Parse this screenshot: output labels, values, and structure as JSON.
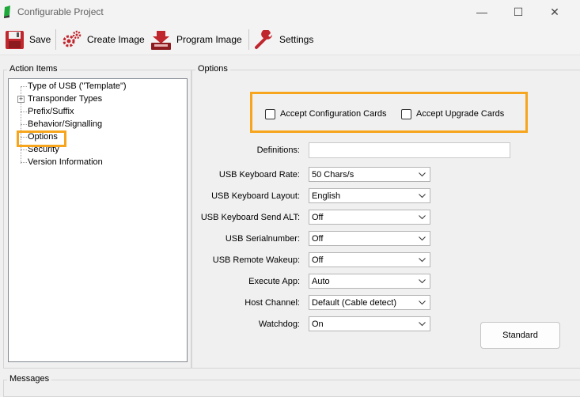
{
  "window": {
    "title": "Configurable Project"
  },
  "toolbar": {
    "save_label": "Save",
    "create_image_label": "Create Image",
    "program_image_label": "Program Image",
    "settings_label": "Settings"
  },
  "action_items": {
    "title": "Action Items",
    "items": [
      "Type of USB (\"Template\")",
      "Transponder Types",
      "Prefix/Suffix",
      "Behavior/Signalling",
      "Options",
      "Security",
      "Version Information"
    ],
    "selected": "Options"
  },
  "options": {
    "title": "Options",
    "accept_config_cards": {
      "label": "Accept Configuration Cards",
      "checked": false
    },
    "accept_upgrade_cards": {
      "label": "Accept Upgrade Cards",
      "checked": false
    },
    "definitions": {
      "label": "Definitions:",
      "value": ""
    },
    "fields": [
      {
        "label": "USB Keyboard Rate:",
        "value": "50 Chars/s"
      },
      {
        "label": "USB Keyboard Layout:",
        "value": "English"
      },
      {
        "label": "USB Keyboard Send ALT:",
        "value": "Off"
      },
      {
        "label": "USB Serialnumber:",
        "value": "Off"
      },
      {
        "label": "USB Remote Wakeup:",
        "value": "Off"
      },
      {
        "label": "Execute App:",
        "value": "Auto"
      },
      {
        "label": "Host Channel:",
        "value": "Default (Cable detect)"
      },
      {
        "label": "Watchdog:",
        "value": "On"
      }
    ],
    "standard_button": "Standard"
  },
  "messages": {
    "title": "Messages"
  },
  "colors": {
    "highlight": "#f6a51c"
  }
}
